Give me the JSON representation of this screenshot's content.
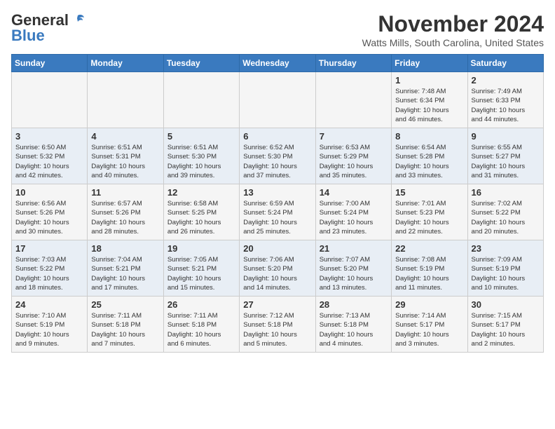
{
  "logo": {
    "general": "General",
    "blue": "Blue"
  },
  "header": {
    "title": "November 2024",
    "subtitle": "Watts Mills, South Carolina, United States"
  },
  "weekdays": [
    "Sunday",
    "Monday",
    "Tuesday",
    "Wednesday",
    "Thursday",
    "Friday",
    "Saturday"
  ],
  "weeks": [
    [
      {
        "day": "",
        "info": ""
      },
      {
        "day": "",
        "info": ""
      },
      {
        "day": "",
        "info": ""
      },
      {
        "day": "",
        "info": ""
      },
      {
        "day": "",
        "info": ""
      },
      {
        "day": "1",
        "info": "Sunrise: 7:48 AM\nSunset: 6:34 PM\nDaylight: 10 hours\nand 46 minutes."
      },
      {
        "day": "2",
        "info": "Sunrise: 7:49 AM\nSunset: 6:33 PM\nDaylight: 10 hours\nand 44 minutes."
      }
    ],
    [
      {
        "day": "3",
        "info": "Sunrise: 6:50 AM\nSunset: 5:32 PM\nDaylight: 10 hours\nand 42 minutes."
      },
      {
        "day": "4",
        "info": "Sunrise: 6:51 AM\nSunset: 5:31 PM\nDaylight: 10 hours\nand 40 minutes."
      },
      {
        "day": "5",
        "info": "Sunrise: 6:51 AM\nSunset: 5:30 PM\nDaylight: 10 hours\nand 39 minutes."
      },
      {
        "day": "6",
        "info": "Sunrise: 6:52 AM\nSunset: 5:30 PM\nDaylight: 10 hours\nand 37 minutes."
      },
      {
        "day": "7",
        "info": "Sunrise: 6:53 AM\nSunset: 5:29 PM\nDaylight: 10 hours\nand 35 minutes."
      },
      {
        "day": "8",
        "info": "Sunrise: 6:54 AM\nSunset: 5:28 PM\nDaylight: 10 hours\nand 33 minutes."
      },
      {
        "day": "9",
        "info": "Sunrise: 6:55 AM\nSunset: 5:27 PM\nDaylight: 10 hours\nand 31 minutes."
      }
    ],
    [
      {
        "day": "10",
        "info": "Sunrise: 6:56 AM\nSunset: 5:26 PM\nDaylight: 10 hours\nand 30 minutes."
      },
      {
        "day": "11",
        "info": "Sunrise: 6:57 AM\nSunset: 5:26 PM\nDaylight: 10 hours\nand 28 minutes."
      },
      {
        "day": "12",
        "info": "Sunrise: 6:58 AM\nSunset: 5:25 PM\nDaylight: 10 hours\nand 26 minutes."
      },
      {
        "day": "13",
        "info": "Sunrise: 6:59 AM\nSunset: 5:24 PM\nDaylight: 10 hours\nand 25 minutes."
      },
      {
        "day": "14",
        "info": "Sunrise: 7:00 AM\nSunset: 5:24 PM\nDaylight: 10 hours\nand 23 minutes."
      },
      {
        "day": "15",
        "info": "Sunrise: 7:01 AM\nSunset: 5:23 PM\nDaylight: 10 hours\nand 22 minutes."
      },
      {
        "day": "16",
        "info": "Sunrise: 7:02 AM\nSunset: 5:22 PM\nDaylight: 10 hours\nand 20 minutes."
      }
    ],
    [
      {
        "day": "17",
        "info": "Sunrise: 7:03 AM\nSunset: 5:22 PM\nDaylight: 10 hours\nand 18 minutes."
      },
      {
        "day": "18",
        "info": "Sunrise: 7:04 AM\nSunset: 5:21 PM\nDaylight: 10 hours\nand 17 minutes."
      },
      {
        "day": "19",
        "info": "Sunrise: 7:05 AM\nSunset: 5:21 PM\nDaylight: 10 hours\nand 15 minutes."
      },
      {
        "day": "20",
        "info": "Sunrise: 7:06 AM\nSunset: 5:20 PM\nDaylight: 10 hours\nand 14 minutes."
      },
      {
        "day": "21",
        "info": "Sunrise: 7:07 AM\nSunset: 5:20 PM\nDaylight: 10 hours\nand 13 minutes."
      },
      {
        "day": "22",
        "info": "Sunrise: 7:08 AM\nSunset: 5:19 PM\nDaylight: 10 hours\nand 11 minutes."
      },
      {
        "day": "23",
        "info": "Sunrise: 7:09 AM\nSunset: 5:19 PM\nDaylight: 10 hours\nand 10 minutes."
      }
    ],
    [
      {
        "day": "24",
        "info": "Sunrise: 7:10 AM\nSunset: 5:19 PM\nDaylight: 10 hours\nand 9 minutes."
      },
      {
        "day": "25",
        "info": "Sunrise: 7:11 AM\nSunset: 5:18 PM\nDaylight: 10 hours\nand 7 minutes."
      },
      {
        "day": "26",
        "info": "Sunrise: 7:11 AM\nSunset: 5:18 PM\nDaylight: 10 hours\nand 6 minutes."
      },
      {
        "day": "27",
        "info": "Sunrise: 7:12 AM\nSunset: 5:18 PM\nDaylight: 10 hours\nand 5 minutes."
      },
      {
        "day": "28",
        "info": "Sunrise: 7:13 AM\nSunset: 5:18 PM\nDaylight: 10 hours\nand 4 minutes."
      },
      {
        "day": "29",
        "info": "Sunrise: 7:14 AM\nSunset: 5:17 PM\nDaylight: 10 hours\nand 3 minutes."
      },
      {
        "day": "30",
        "info": "Sunrise: 7:15 AM\nSunset: 5:17 PM\nDaylight: 10 hours\nand 2 minutes."
      }
    ]
  ]
}
